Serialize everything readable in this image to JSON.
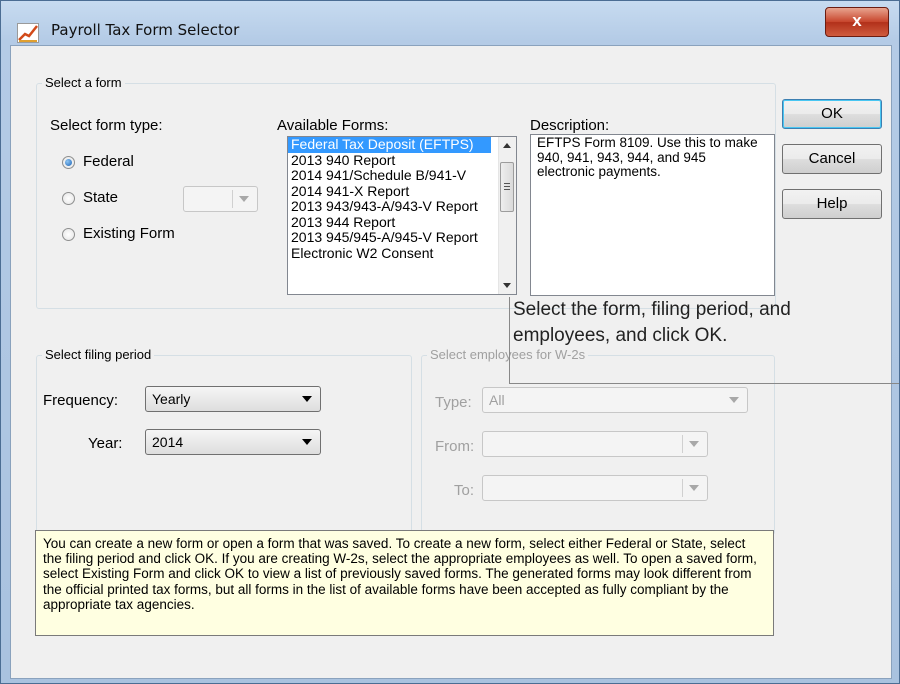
{
  "window": {
    "title": "Payroll Tax Form Selector",
    "close_glyph": "x"
  },
  "select_form": {
    "group_label": "Select a form",
    "form_type_label": "Select form type:",
    "radios": [
      {
        "label": "Federal",
        "checked": true
      },
      {
        "label": "State",
        "checked": false
      },
      {
        "label": "Existing Form",
        "checked": false
      }
    ],
    "state_combo_value": "",
    "available_label": "Available Forms:",
    "available_forms": [
      "Federal Tax Deposit (EFTPS)",
      "2013 940 Report",
      "2014 941/Schedule B/941-V",
      "2014 941-X Report",
      "2013 943/943-A/943-V Report",
      "2013 944 Report",
      "2013 945/945-A/945-V Report",
      "Electronic W2 Consent"
    ],
    "selected_form_index": 0,
    "description_label": "Description:",
    "description_text": "EFTPS Form 8109.  Use this to make 940, 941, 943, 944, and 945 electronic payments."
  },
  "buttons": {
    "ok": "OK",
    "cancel": "Cancel",
    "help": "Help"
  },
  "callout": {
    "text": "Select the form, filing period, and employees, and click OK."
  },
  "filing_period": {
    "group_label": "Select filing period",
    "frequency_label": "Frequency:",
    "frequency_value": "Yearly",
    "year_label": "Year:",
    "year_value": "2014"
  },
  "employees": {
    "group_label": "Select employees for W-2s",
    "type_label": "Type:",
    "type_value": "All",
    "from_label": "From:",
    "to_label": "To:"
  },
  "help_text": "You can create a new form or open a form that was saved. To create a new form, select either Federal or State, select the filing period and click OK. If you are creating W-2s, select the appropriate employees as well. To open a saved form, select Existing Form and click OK to view a list of previously saved forms. The generated forms may look different from the official printed tax forms, but all forms in the list of available forms have been accepted as fully compliant by the appropriate tax agencies."
}
